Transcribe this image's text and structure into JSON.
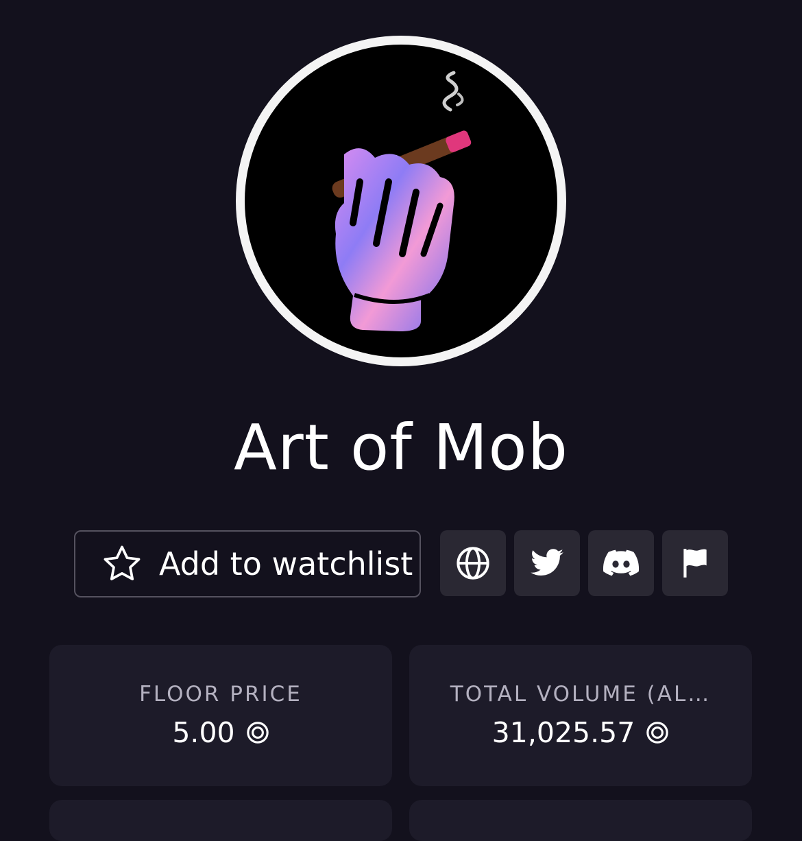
{
  "collection": {
    "name": "Art of Mob",
    "avatar_icon": "cigar-hand-logo"
  },
  "actions": {
    "watchlist_label": "Add to watchlist",
    "watchlist_icon": "star-icon",
    "links": [
      {
        "name": "website",
        "icon": "globe-icon"
      },
      {
        "name": "twitter",
        "icon": "twitter-icon"
      },
      {
        "name": "discord",
        "icon": "discord-icon"
      },
      {
        "name": "report",
        "icon": "flag-icon"
      }
    ]
  },
  "stats": [
    {
      "label": "FLOOR PRICE",
      "value": "5.00",
      "currency_icon": "solana-coin-icon"
    },
    {
      "label": "TOTAL VOLUME (AL…",
      "value": "31,025.57",
      "currency_icon": "solana-coin-icon"
    }
  ],
  "colors": {
    "background": "#13111d",
    "card": "#1d1b29",
    "button": "#2a2833",
    "label": "#b4b1c0"
  }
}
